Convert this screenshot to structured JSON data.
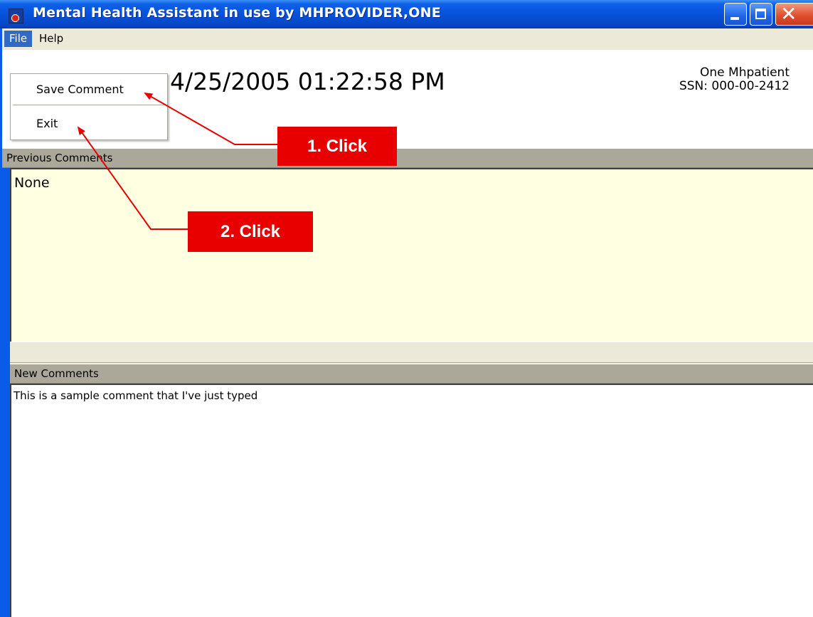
{
  "window": {
    "title": "Mental Health Assistant in use by MHPROVIDER,ONE"
  },
  "menubar": {
    "items": [
      {
        "label": "File"
      },
      {
        "label": "Help"
      }
    ]
  },
  "file_menu": {
    "items": [
      {
        "label": "Save Comment"
      },
      {
        "label": "Exit"
      }
    ]
  },
  "header": {
    "datetime": "4/25/2005 01:22:58 PM",
    "patient_name": "One Mhpatient",
    "patient_ssn": "SSN: 000-00-2412"
  },
  "previous_comments": {
    "heading": "Previous Comments",
    "text": "None"
  },
  "new_comments": {
    "heading": "New Comments",
    "text": "This is a sample comment that I've just typed"
  },
  "annotations": [
    {
      "label": "1. Click"
    },
    {
      "label": "2. Click"
    }
  ],
  "colors": {
    "titlebar": "#0A5BE8",
    "menu_highlight": "#316AC5",
    "previous_bg": "#FFFFE1",
    "callout": "#E80000"
  }
}
